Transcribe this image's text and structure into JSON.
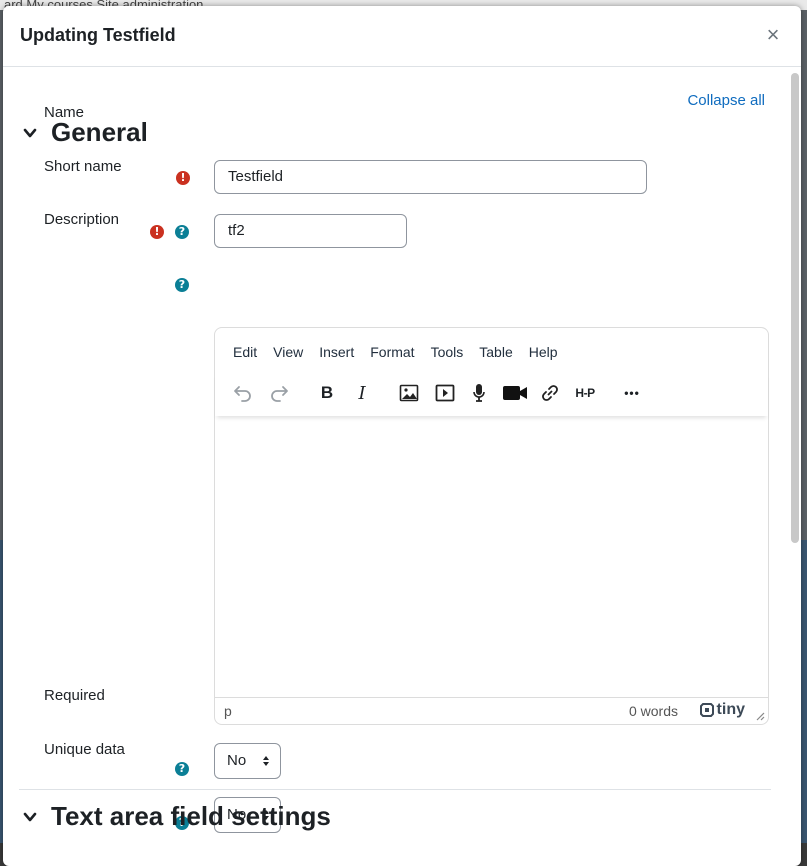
{
  "backdrop": {
    "nav_text": "ard  My courses  Site administration"
  },
  "modal": {
    "title": "Updating Testfield",
    "close_symbol": "×"
  },
  "form": {
    "collapse_all": "Collapse all",
    "sections": {
      "general": "General",
      "textarea": "Text area field settings"
    },
    "fields": {
      "name": {
        "label": "Name",
        "value": "Testfield"
      },
      "short_name": {
        "label": "Short name",
        "value": "tf2"
      },
      "description": {
        "label": "Description"
      },
      "required": {
        "label": "Required",
        "value": "No"
      },
      "unique": {
        "label": "Unique data",
        "value": "No"
      }
    },
    "icons": {
      "required": "!",
      "help": "?"
    }
  },
  "editor": {
    "menus": [
      "Edit",
      "View",
      "Insert",
      "Format",
      "Tools",
      "Table",
      "Help"
    ],
    "toolbar_icons": [
      "undo-icon",
      "redo-icon",
      "bold-icon",
      "italic-icon",
      "image-icon",
      "media-icon",
      "microphone-icon",
      "video-camera-icon",
      "link-icon",
      "h5p-icon",
      "more-icon"
    ],
    "bold_glyph": "B",
    "italic_glyph": "I",
    "h5p_label": "H-P",
    "more_glyph": "•••",
    "status_path": "p",
    "word_count": "0 words",
    "brand": "tiny"
  },
  "colors": {
    "link": "#0f6cbf",
    "required_icon": "#ca3120",
    "help_icon": "#0b7f96"
  }
}
